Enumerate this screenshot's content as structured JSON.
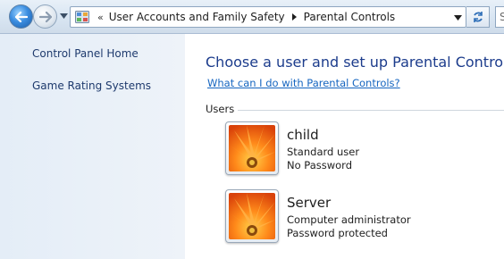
{
  "address_bar": {
    "overflow_glyph": "«",
    "crumbs": [
      "User Accounts and Family Safety",
      "Parental Controls"
    ]
  },
  "search": {
    "placeholder": "S"
  },
  "sidebar": {
    "items": [
      {
        "label": "Control Panel Home"
      },
      {
        "label": "Game Rating Systems"
      }
    ]
  },
  "main": {
    "title": "Choose a user and set up Parental Controls",
    "help_link": "What can I do with Parental Controls?",
    "users_section_label": "Users",
    "users": [
      {
        "name": "child",
        "account_type": "Standard user",
        "password_status": "No Password",
        "picture": "orange-flower-picture"
      },
      {
        "name": "Server",
        "account_type": "Computer administrator",
        "password_status": "Password protected",
        "picture": "orange-flower-picture"
      }
    ]
  },
  "colors": {
    "title": "#1c3c8c",
    "link": "#1565c0",
    "sidebar_link": "#1e3a6d",
    "sidebar_bg": "#e4edf7"
  }
}
